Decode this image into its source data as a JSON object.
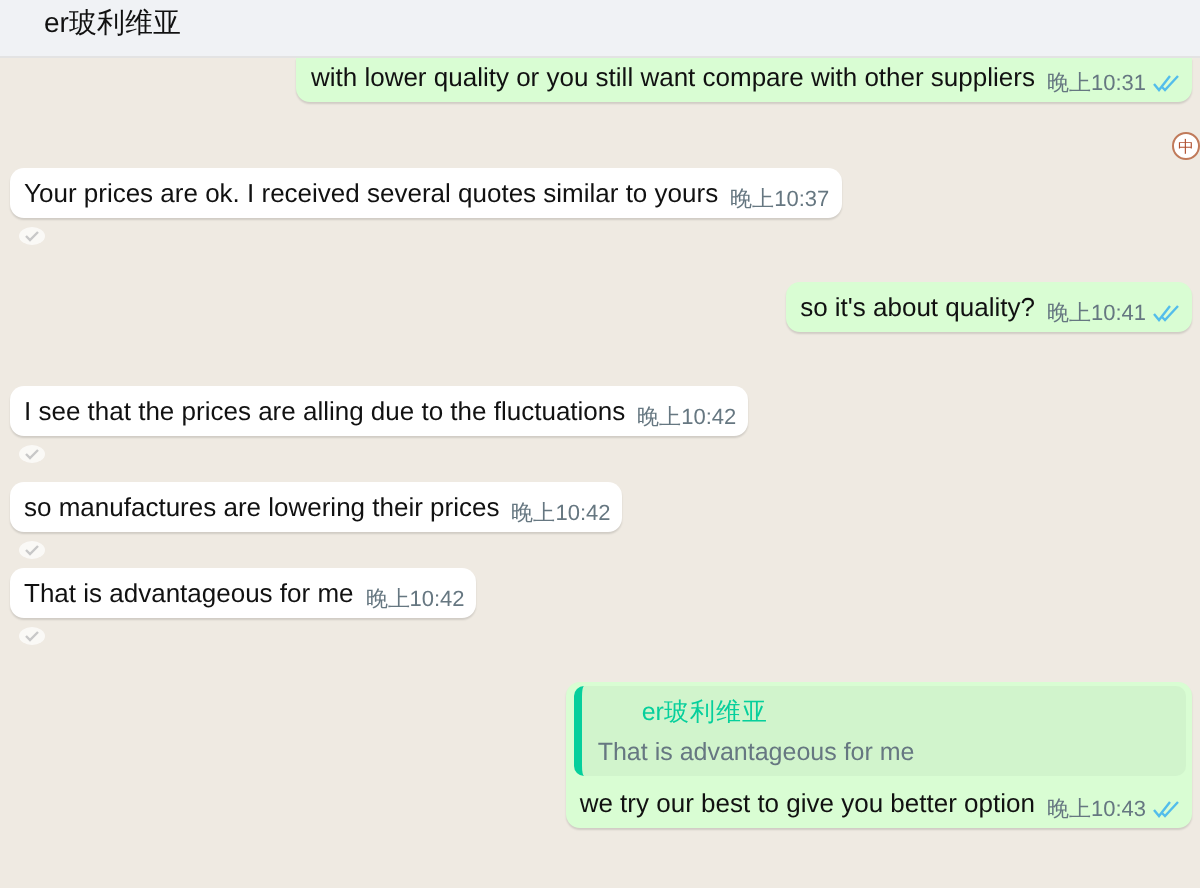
{
  "header": {
    "title": "er玻利维亚"
  },
  "ime_badge": "中",
  "messages": [
    {
      "kind": "sent",
      "text": "with lower quality or you still want compare with other suppliers",
      "time": "晚上10:31",
      "read": true
    },
    {
      "kind": "received",
      "text": "Your prices are ok. I received several quotes similar to yours",
      "time": "晚上10:37"
    },
    {
      "kind": "sent",
      "text": "so it's about quality?",
      "time": "晚上10:41",
      "read": true
    },
    {
      "kind": "received",
      "text": "I see that the prices are alling due to the fluctuations",
      "time": "晚上10:42"
    },
    {
      "kind": "received",
      "text": "so manufactures are lowering their prices",
      "time": "晚上10:42"
    },
    {
      "kind": "received",
      "text": "That is advantageous for me",
      "time": "晚上10:42"
    },
    {
      "kind": "sent",
      "quote": {
        "author": "er玻利维亚",
        "text": "That is advantageous for me"
      },
      "text": "we try our best to give you better option",
      "time": "晚上10:43",
      "read": true
    }
  ]
}
